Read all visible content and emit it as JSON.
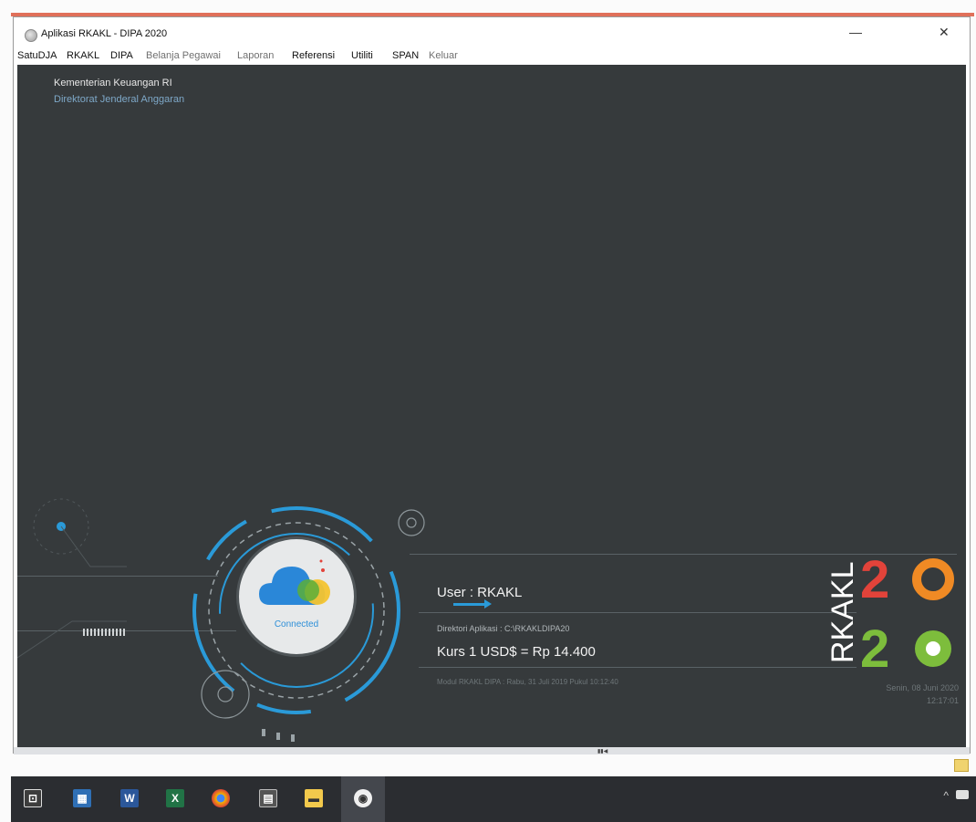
{
  "window": {
    "title": "Aplikasi RKAKL - DIPA 2020",
    "minimize_glyph": "—",
    "close_glyph": "✕"
  },
  "menu": [
    {
      "label": "SatuDJA",
      "enabled": true
    },
    {
      "label": "RKAKL",
      "enabled": true
    },
    {
      "label": "DIPA",
      "enabled": true
    },
    {
      "label": "Belanja Pegawai",
      "enabled": false
    },
    {
      "label": "Laporan",
      "enabled": false
    },
    {
      "label": "Referensi",
      "enabled": true
    },
    {
      "label": "Utiliti",
      "enabled": true
    },
    {
      "label": "SPAN",
      "enabled": true
    },
    {
      "label": "Keluar",
      "enabled": false
    }
  ],
  "org": {
    "line1": "Kementerian Keuangan RI",
    "line2": "Direktorat Jenderal Anggaran"
  },
  "status": {
    "connection": "Connected",
    "user": "User : RKAKL",
    "directory": "Direktori Aplikasi : C:\\RKAKLDIPA20",
    "kurs": "Kurs 1 USD$ = Rp 14.400",
    "modul": "Modul RKAKL DIPA : Rabu, 31 Juli 2019 Pukul 10:12:40",
    "date": "Senin, 08 Juni 2020",
    "time": "12:17:01"
  },
  "logo": {
    "vertical_text": "RKAKL",
    "year_top": "2",
    "year_bottom": "2",
    "colors": {
      "red": "#e2433a",
      "orange": "#f08a24",
      "green": "#7dbd3c",
      "white": "#ffffff"
    }
  },
  "taskbar": {
    "icons": [
      "store-icon",
      "calendar-app-icon",
      "word-icon",
      "excel-icon",
      "chrome-icon",
      "calculator-icon",
      "file-explorer-icon",
      "rkakl-app-icon"
    ],
    "tray_chevron": "^"
  },
  "colors": {
    "background": "#363a3c",
    "accent_blue": "#2a9ad8",
    "title_accent": "#e0705a"
  }
}
